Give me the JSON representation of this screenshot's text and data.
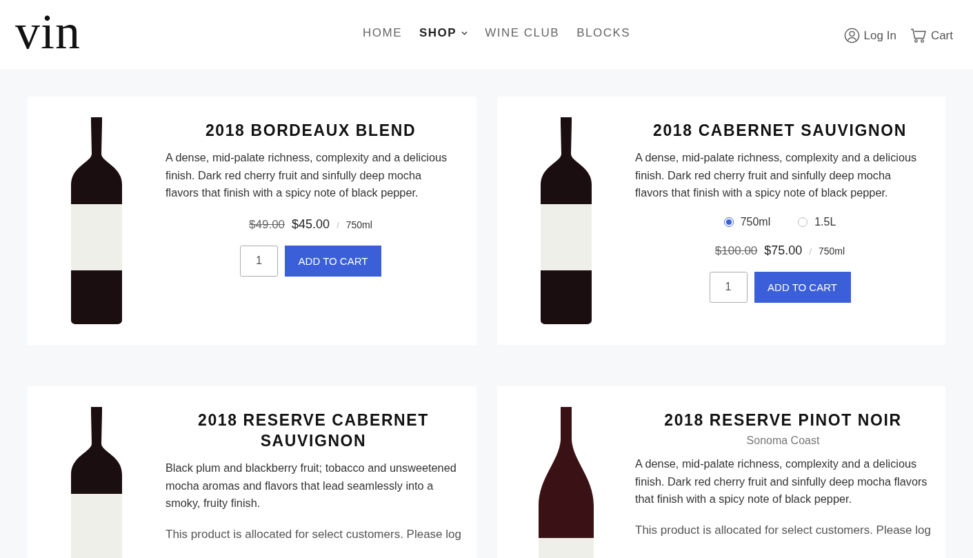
{
  "header": {
    "logo": "vin",
    "nav": [
      {
        "label": "HOME",
        "selected": false,
        "dropdown": false
      },
      {
        "label": "SHOP",
        "selected": true,
        "dropdown": true
      },
      {
        "label": "WINE CLUB",
        "selected": false,
        "dropdown": false
      },
      {
        "label": "BLOCKS",
        "selected": false,
        "dropdown": false
      }
    ],
    "login": "Log In",
    "cart": "Cart"
  },
  "products": [
    {
      "kind": "bordeaux",
      "title": "2018 BORDEAUX BLEND",
      "description": "A dense, mid-palate richness, complexity and a delicious finish. Dark red cherry fruit and sinfully deep mocha flavors that finish with a spicy note of black pepper.",
      "price_old": "$49.00",
      "price": "$45.00",
      "separator": "/",
      "size": "750ml",
      "quantity": "1",
      "button": "ADD TO CART"
    },
    {
      "kind": "bordeaux",
      "title": "2018 CABERNET SAUVIGNON",
      "description": "A dense, mid-palate richness, complexity and a delicious finish. Dark red cherry fruit and sinfully deep mocha flavors that finish with a spicy note of black pepper.",
      "variants": [
        {
          "label": "750ml",
          "selected": true
        },
        {
          "label": "1.5L",
          "selected": false
        }
      ],
      "price_old": "$100.00",
      "price": "$75.00",
      "separator": "/",
      "size": "750ml",
      "quantity": "1",
      "button": "ADD TO CART"
    },
    {
      "kind": "bordeaux",
      "title": "2018 RESERVE CABERNET SAUVIGNON",
      "description": "Black plum and blackberry fruit; tobacco and unsweetened mocha aromas and flavors that lead seamlessly into a smoky, fruity finish.",
      "note": "This product is allocated for select customers. Please log"
    },
    {
      "kind": "burgundy",
      "title": "2018 RESERVE PINOT NOIR",
      "region": "Sonoma Coast",
      "description": "A dense, mid-palate richness, complexity and a delicious finish. Dark red cherry fruit and sinfully deep mocha flavors that finish with a spicy note of black pepper.",
      "note": "This product is allocated for select customers. Please log"
    }
  ]
}
